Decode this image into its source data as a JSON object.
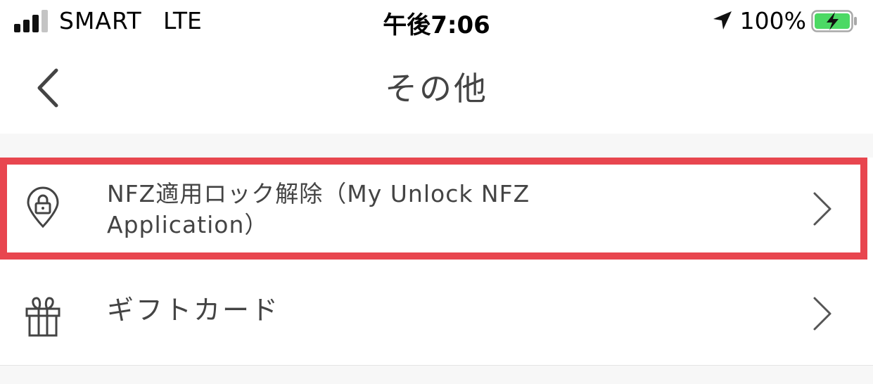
{
  "status_bar": {
    "carrier": "SMART",
    "network": "LTE",
    "time": "午後7:06",
    "battery_percent": "100%",
    "icons": [
      "signal-icon",
      "location-arrow-icon",
      "battery-charging-icon"
    ]
  },
  "nav": {
    "title": "その他",
    "back_icon": "chevron-left-icon"
  },
  "list": {
    "items": [
      {
        "label": "NFZ適用ロック解除（My Unlock NFZ Application）",
        "icon": "location-lock-icon",
        "chevron": "chevron-right-icon",
        "highlighted": true
      },
      {
        "label": "ギフトカード",
        "icon": "gift-icon",
        "chevron": "chevron-right-icon",
        "highlighted": false
      }
    ]
  },
  "colors": {
    "highlight": "#e8464f",
    "text": "#444444",
    "battery": "#4cd964"
  }
}
